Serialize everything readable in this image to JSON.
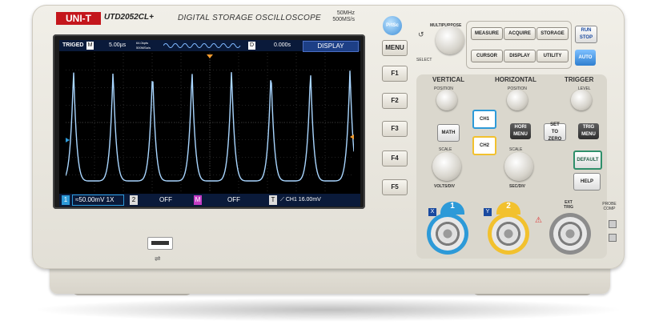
{
  "brand": "UNI-T",
  "model": "UTD2052CL+",
  "subtitle": "DIGITAL STORAGE OSCILLOSCOPE",
  "specs": [
    "50MHz",
    "500MS/s"
  ],
  "screen": {
    "top_bar": {
      "status": "TRIGED",
      "mode": "M",
      "timebase": "5.00µs",
      "sample_line1": "64.0kpts",
      "sample_line2": "500MSa/s",
      "delay_marker": "D",
      "delay": "0.000s",
      "menu_title": "DISPLAY"
    },
    "bottom_bar": {
      "ch1_marker": "1",
      "ch1_setting": "≈50.00mV 1X",
      "ch2_marker": "2",
      "ch2_setting": "OFF",
      "math_marker": "M",
      "math_setting": "OFF",
      "trigger_marker": "T",
      "trigger_setting": "CH1 16.00mV"
    },
    "waveform": {
      "channel": "CH1",
      "color": "#a9d6ff",
      "pulses": 7
    }
  },
  "side_buttons": {
    "prtsc": "PrtSc",
    "menu": "MENU",
    "f_keys": [
      "F1",
      "F2",
      "F3",
      "F4",
      "F5"
    ]
  },
  "multipurpose": {
    "label": "MULTIPURPOSE",
    "select": "SELECT"
  },
  "function_keys": {
    "measure": "MEASURE",
    "acquire": "ACQUIRE",
    "storage": "STORAGE",
    "cursor": "CURSOR",
    "display": "DISPLAY",
    "utility": "UTILITY",
    "run_stop_1": "RUN",
    "run_stop_2": "STOP",
    "auto": "AUTO"
  },
  "vertical": {
    "title": "VERTICAL",
    "position": "POSITION",
    "math": "MATH",
    "ch1": "CH1",
    "ch2": "CH2",
    "scale": "SCALE",
    "volts_div": "VOLTS/DIV"
  },
  "horizontal": {
    "title": "HORIZONTAL",
    "position": "POSITION",
    "hori_menu_1": "HORI",
    "hori_menu_2": "MENU",
    "scale": "SCALE",
    "sec_div": "SEC/DIV"
  },
  "trigger": {
    "title": "TRIGGER",
    "level": "LEVEL",
    "set_to_zero_1": "SET",
    "set_to_zero_2": "TO ZERO",
    "trig_menu_1": "TRIG",
    "trig_menu_2": "MENU",
    "default": "DEFAULT",
    "help": "HELP"
  },
  "inputs": {
    "ch1_letter": "X",
    "ch1_number": "1",
    "ch2_letter": "Y",
    "ch2_number": "2",
    "ext_trig_1": "EXT",
    "ext_trig_2": "TRIG",
    "probe_comp": "PROBE COMP"
  },
  "colors": {
    "brand_red": "#c4161c",
    "ch1_blue": "#2d9ad8",
    "ch2_yellow": "#f2c12e",
    "auto_blue": "#3f8fd8",
    "default_green": "#2f8f6a"
  }
}
